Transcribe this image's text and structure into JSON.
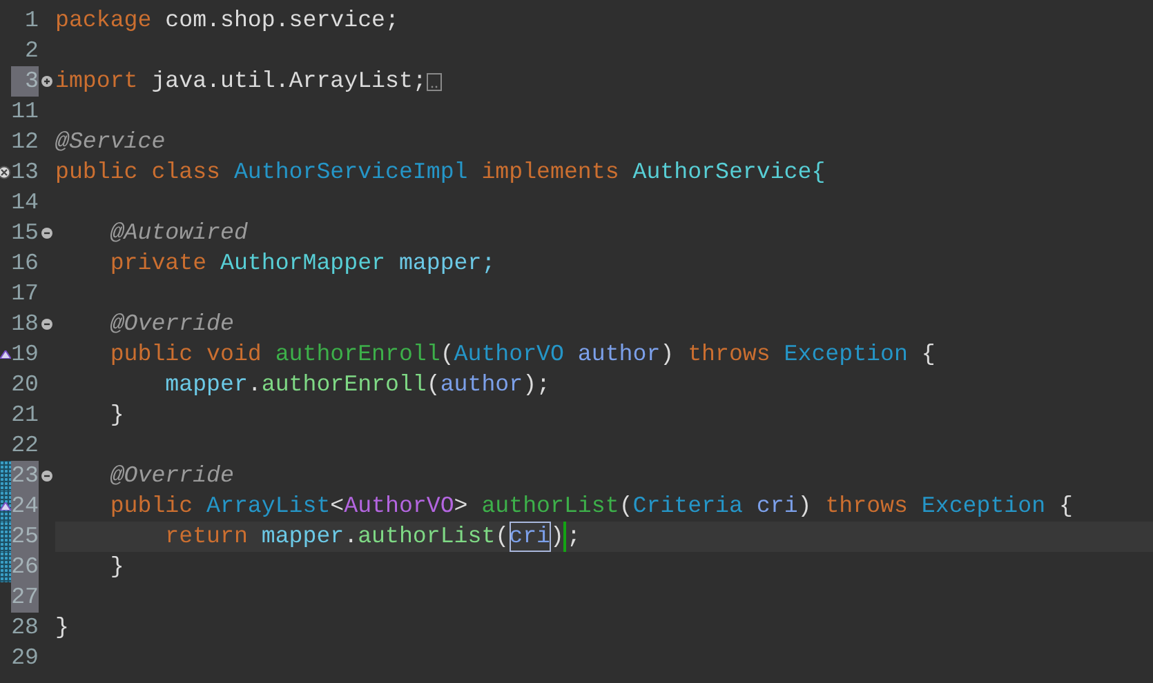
{
  "editor": {
    "lines": [
      {
        "number": "1",
        "highlighted": false,
        "current": false,
        "change_bar": false,
        "tokens": [
          {
            "text": "package",
            "kind": "keyword"
          },
          {
            "text": "com.shop.service;",
            "kind": "plain",
            "sp": true
          }
        ]
      },
      {
        "number": "2",
        "highlighted": false,
        "current": false,
        "change_bar": false
      },
      {
        "number": "3",
        "highlighted": true,
        "current": false,
        "change_bar": false,
        "fold": {
          "kind": "expand"
        },
        "folded": true,
        "tokens": [
          {
            "text": "import",
            "kind": "keyword"
          },
          {
            "text": "java.util.ArrayList;",
            "kind": "plain",
            "sp": true
          }
        ]
      },
      {
        "number": "11",
        "highlighted": false,
        "current": false,
        "change_bar": false
      },
      {
        "number": "12",
        "highlighted": false,
        "current": false,
        "change_bar": false,
        "tokens": [
          {
            "text": "@Service",
            "kind": "annotation"
          }
        ]
      },
      {
        "number": "13",
        "highlighted": false,
        "current": false,
        "change_bar": false,
        "marker": {
          "kind": "implements"
        },
        "tokens": [
          {
            "text": "public",
            "kind": "keyword"
          },
          {
            "text": "class",
            "kind": "keyword",
            "sp": true
          },
          {
            "text": "AuthorServiceImpl",
            "kind": "class",
            "sp": true
          },
          {
            "text": "implements",
            "kind": "keyword",
            "sp": true
          },
          {
            "text": "AuthorService{",
            "kind": "interface",
            "sp": true
          }
        ],
        "children": [
          {
            "number": "14",
            "highlighted": false,
            "current": false,
            "change_bar": false
          },
          {
            "number": "15",
            "highlighted": false,
            "current": false,
            "change_bar": false,
            "fold": {
              "kind": "collapse"
            },
            "tokens": [
              {
                "text": "@Autowired",
                "kind": "annotation"
              }
            ]
          },
          {
            "number": "16",
            "highlighted": false,
            "current": false,
            "change_bar": false,
            "tokens": [
              {
                "text": "private",
                "kind": "keyword"
              },
              {
                "text": "AuthorMapper",
                "kind": "interface",
                "sp": true
              },
              {
                "text": "mapper;",
                "kind": "field",
                "sp": true
              }
            ]
          },
          {
            "number": "17",
            "highlighted": false,
            "current": false,
            "change_bar": false
          },
          {
            "number": "18",
            "highlighted": false,
            "current": false,
            "change_bar": false,
            "fold": {
              "kind": "collapse"
            },
            "tokens": [
              {
                "text": "@Override",
                "kind": "annotation"
              }
            ]
          },
          {
            "number": "19",
            "highlighted": false,
            "current": false,
            "change_bar": false,
            "marker": {
              "kind": "overrides"
            },
            "tokens": [
              {
                "text": "public",
                "kind": "keyword"
              },
              {
                "text": "void",
                "kind": "keyword",
                "sp": true
              },
              {
                "text": "authorEnroll",
                "kind": "method",
                "sp": true
              },
              {
                "text": "(",
                "kind": "plain"
              },
              {
                "text": "AuthorVO",
                "kind": "class"
              },
              {
                "text": "author",
                "kind": "param",
                "sp": true
              },
              {
                "text": ")",
                "kind": "plain"
              },
              {
                "text": "throws",
                "kind": "keyword",
                "sp": true
              },
              {
                "text": "Exception",
                "kind": "class",
                "sp": true
              },
              {
                "text": "{",
                "kind": "plain",
                "sp": true
              }
            ],
            "children": [
              {
                "number": "20",
                "highlighted": false,
                "current": false,
                "change_bar": false,
                "tokens": [
                  {
                    "text": "mapper",
                    "kind": "field"
                  },
                  {
                    "text": ".",
                    "kind": "plain"
                  },
                  {
                    "text": "authorEnroll",
                    "kind": "call"
                  },
                  {
                    "text": "(",
                    "kind": "plain"
                  },
                  {
                    "text": "author",
                    "kind": "param"
                  },
                  {
                    "text": ");",
                    "kind": "plain"
                  }
                ]
              }
            ]
          },
          {
            "number": "21",
            "highlighted": false,
            "current": false,
            "change_bar": false,
            "tokens": [
              {
                "text": "}",
                "kind": "plain"
              }
            ]
          },
          {
            "number": "22",
            "highlighted": false,
            "current": false,
            "change_bar": false
          },
          {
            "number": "23",
            "highlighted": true,
            "current": false,
            "change_bar": true,
            "fold": {
              "kind": "collapse"
            },
            "tokens": [
              {
                "text": "@Override",
                "kind": "annotation"
              }
            ]
          },
          {
            "number": "24",
            "highlighted": true,
            "current": false,
            "change_bar": true,
            "marker": {
              "kind": "overrides"
            },
            "tokens": [
              {
                "text": "public",
                "kind": "keyword"
              },
              {
                "text": "ArrayList",
                "kind": "class",
                "sp": true
              },
              {
                "text": "<",
                "kind": "plain"
              },
              {
                "text": "AuthorVO",
                "kind": "typearg"
              },
              {
                "text": ">",
                "kind": "plain"
              },
              {
                "text": "authorList",
                "kind": "method",
                "sp": true
              },
              {
                "text": "(",
                "kind": "plain"
              },
              {
                "text": "Criteria",
                "kind": "class"
              },
              {
                "text": "cri",
                "kind": "param",
                "sp": true
              },
              {
                "text": ")",
                "kind": "plain"
              },
              {
                "text": "throws",
                "kind": "keyword",
                "sp": true
              },
              {
                "text": "Exception",
                "kind": "class",
                "sp": true
              },
              {
                "text": "{",
                "kind": "plain",
                "sp": true
              }
            ],
            "children": [
              {
                "number": "25",
                "highlighted": true,
                "current": true,
                "change_bar": true,
                "tokens": [
                  {
                    "text": "return",
                    "kind": "keyword"
                  },
                  {
                    "text": "mapper",
                    "kind": "field",
                    "sp": true
                  },
                  {
                    "text": ".",
                    "kind": "plain"
                  },
                  {
                    "text": "authorList",
                    "kind": "call"
                  },
                  {
                    "text": "(",
                    "kind": "plain"
                  },
                  {
                    "text": "cri",
                    "kind": "param",
                    "boxed": true
                  },
                  {
                    "text": ")",
                    "kind": "plain",
                    "caret": true
                  },
                  {
                    "text": ";",
                    "kind": "plain"
                  }
                ]
              }
            ]
          },
          {
            "number": "26",
            "highlighted": true,
            "current": false,
            "change_bar": true,
            "tokens": [
              {
                "text": "}",
                "kind": "plain"
              }
            ]
          },
          {
            "number": "27",
            "highlighted": true,
            "current": false,
            "change_bar": false
          }
        ]
      },
      {
        "number": "28",
        "highlighted": false,
        "current": false,
        "change_bar": false,
        "tokens": [
          {
            "text": "}",
            "kind": "plain"
          }
        ]
      },
      {
        "number": "29",
        "highlighted": false,
        "current": false,
        "change_bar": false
      }
    ]
  }
}
